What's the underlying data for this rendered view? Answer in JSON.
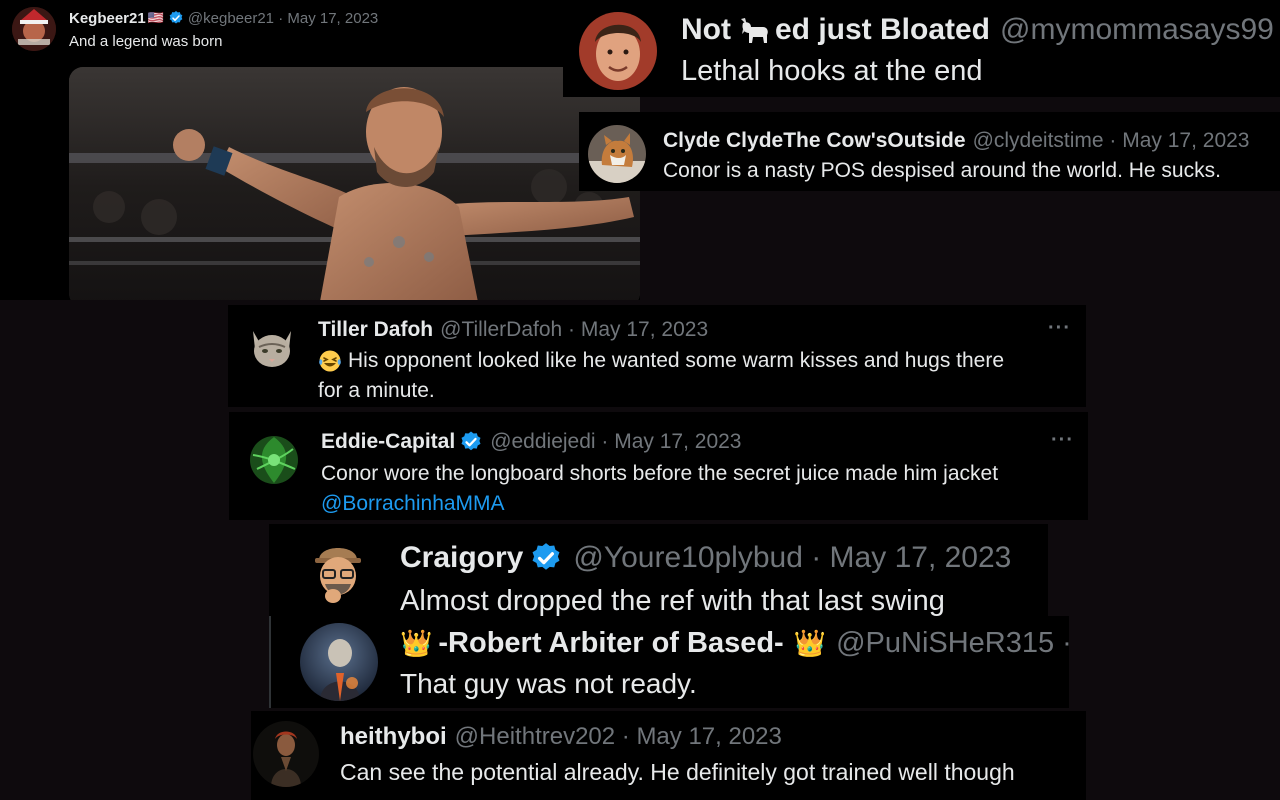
{
  "tweets": {
    "kegbeer": {
      "name": "Kegbeer21",
      "flag": "🇺🇸",
      "handle_date": "@kegbeer21 · May 17, 2023",
      "text": "And a legend was born"
    },
    "mymomma": {
      "name_a": "Not",
      "name_b": "ed just Bloated",
      "handle": "@mymommasays99",
      "text": "Lethal hooks at the end"
    },
    "clyde": {
      "name": "Clyde ClydeThe Cow'sOutside",
      "handle_date": "@clydeitstime · May 17, 2023",
      "text": "Conor is a nasty POS despised around the world. He sucks."
    },
    "tiller": {
      "name": "Tiller Dafoh",
      "handle_date": "@TillerDafoh · May 17, 2023",
      "emoji": "😂",
      "text_line1": "His opponent looked like he wanted some warm kisses and hugs there",
      "text_line2": "for a minute.",
      "more": "···"
    },
    "eddie": {
      "name": "Eddie-Capital",
      "handle_date": "@eddiejedi · May 17, 2023",
      "text_line1": "Conor wore the longboard shorts before the secret juice made him jacket",
      "mention": "@BorrachinhaMMA",
      "more": "···"
    },
    "craigory": {
      "name": "Craigory",
      "handle_date": "@Youre10plybud · May 17, 2023",
      "text": "Almost dropped the ref with that last swing"
    },
    "robert": {
      "crown": "👑",
      "name": "-Robert Arbiter of Based-",
      "handle": "@PuNiSHeR315",
      "sep": "·",
      "text": "That guy was not ready."
    },
    "heithy": {
      "name": "heithyboi",
      "handle_date": "@Heithtrev202 · May 17, 2023",
      "text": "Can see the potential already. He definitely got trained well though"
    }
  },
  "colors": {
    "verified": "#1d9bf0",
    "link": "#1d9bf0",
    "meta": "#71767b"
  }
}
